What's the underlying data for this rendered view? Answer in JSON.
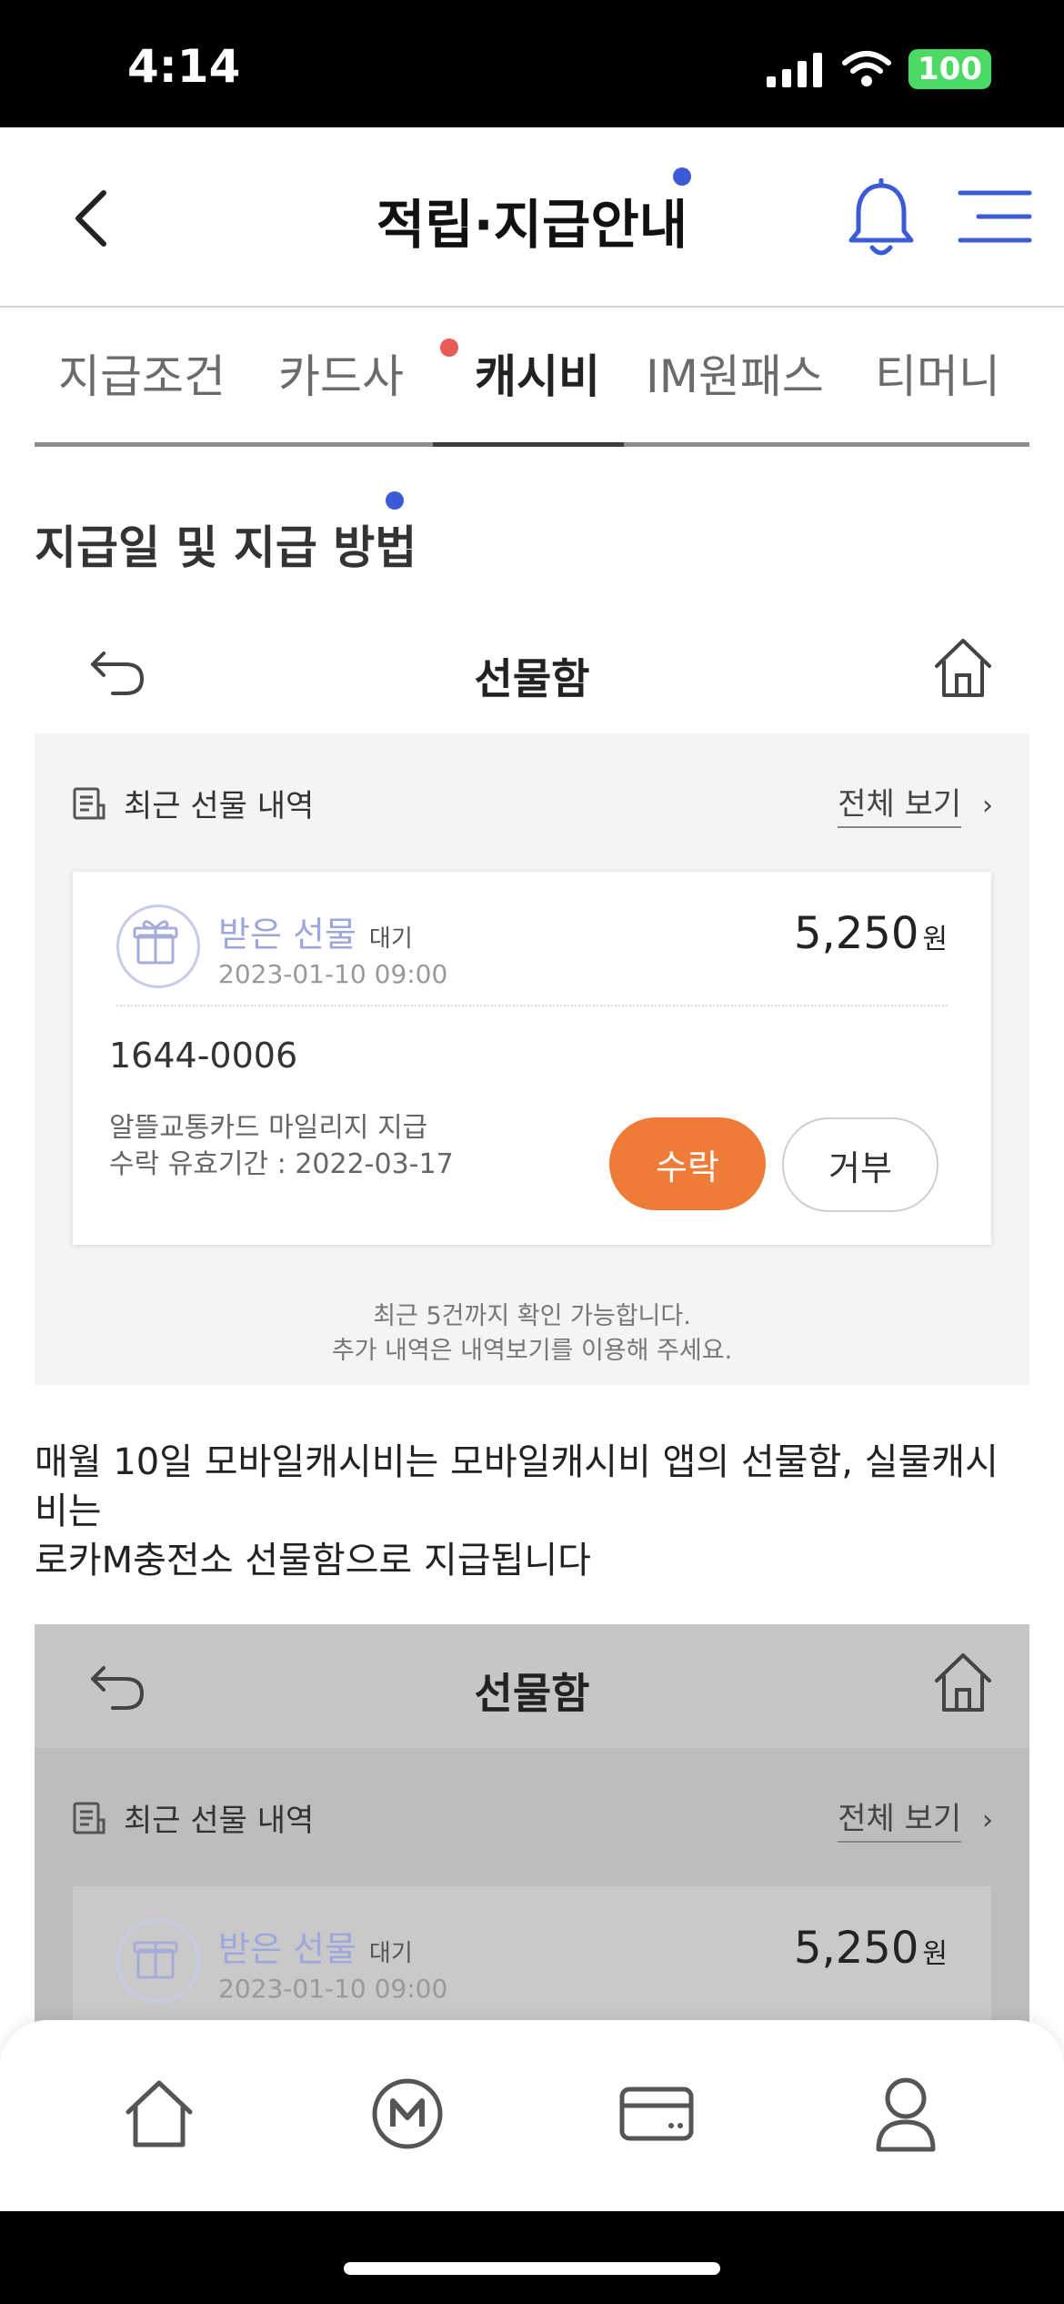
{
  "status_bar": {
    "time": "4:14",
    "battery": "100"
  },
  "header": {
    "title": "적립·지급안내"
  },
  "tabs": [
    {
      "label": "지급조건"
    },
    {
      "label": "카드사"
    },
    {
      "label": "캐시비",
      "active": true
    },
    {
      "label": "IM원패스"
    },
    {
      "label": "티머니"
    }
  ],
  "section": {
    "title": "지급일 및 지급 방법"
  },
  "mock": {
    "title": "선물함",
    "recent_label": "최근 선물 내역",
    "view_all": "전체 보기",
    "gift": {
      "title": "받은 선물",
      "status": "대기",
      "date": "2023-01-10 09:00",
      "amount": "5,250",
      "unit": "원",
      "phone": "1644-0006",
      "desc_line1": "알뜰교통카드 마일리지 지급",
      "desc_line2": "수락 유효기간 : 2022-03-17",
      "accept": "수락",
      "reject": "거부"
    },
    "note_line1": "최근 5건까지 확인 가능합니다.",
    "note_line2": "추가 내역은 내역보기를 이용해 주세요."
  },
  "description": {
    "line1": "매월 10일 모바일캐시비는 모바일캐시비 앱의 선물함, 실물캐시비는",
    "line2": "로카M충전소 선물함으로 지급됩니다"
  },
  "bottom_nav": {
    "items": [
      {
        "icon": "home-icon"
      },
      {
        "icon": "m-logo-icon"
      },
      {
        "icon": "card-icon"
      },
      {
        "icon": "profile-icon"
      }
    ]
  },
  "colors": {
    "accent": "#3b5bd6",
    "accept": "#ee7b38",
    "tab_dot": "#e85b57"
  }
}
